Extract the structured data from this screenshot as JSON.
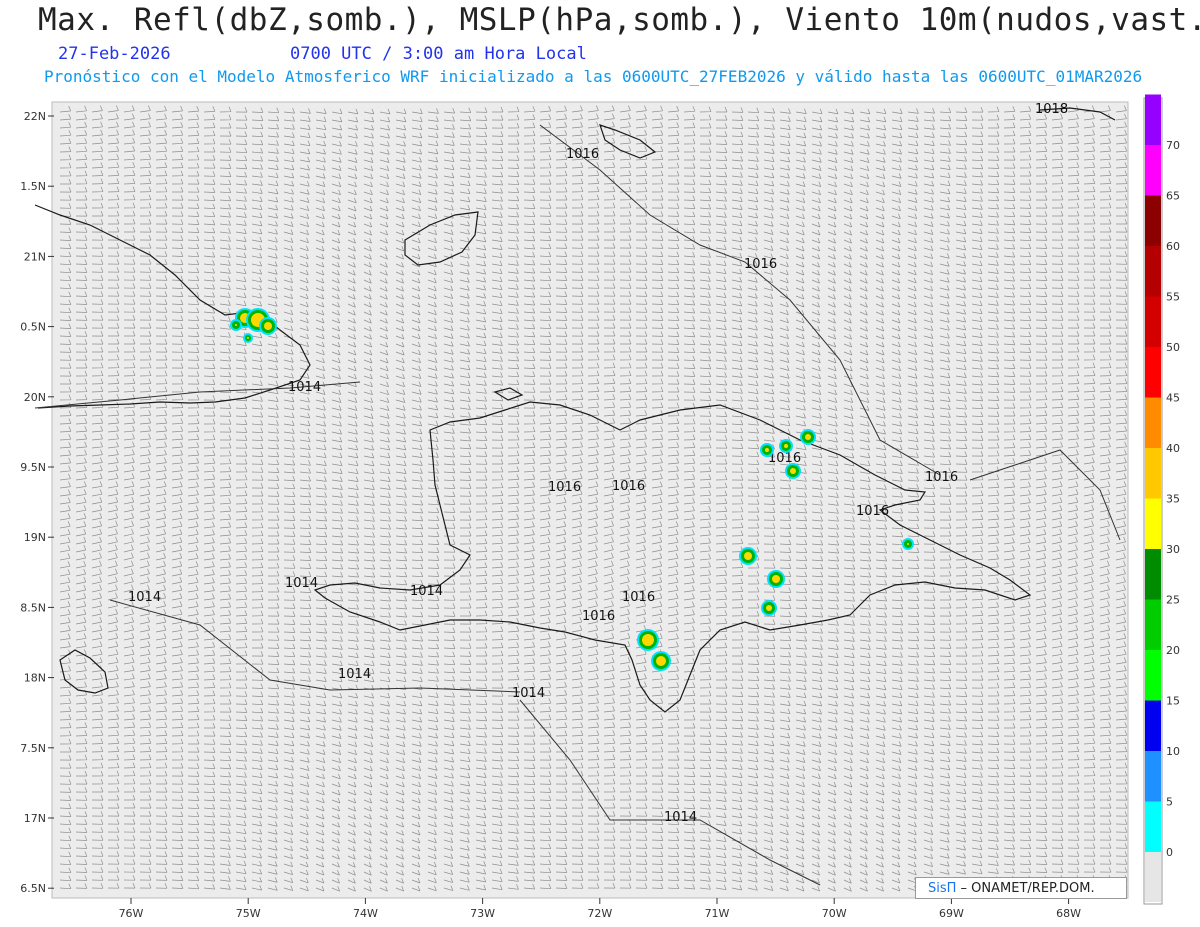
{
  "header": {
    "title": "Max. Refl(dbZ,somb.), MSLP(hPa,somb.), Viento 10m(nudos,vast.)",
    "date": "27-Feb-2026",
    "time": "0700 UTC / 3:00 am Hora Local",
    "description": "Pronóstico con el Modelo Atmosferico WRF inicializado a las 0600UTC_27FEB2026 y válido hasta las  0600UTC_01MAR2026"
  },
  "axes": {
    "lat_labels": [
      "22N",
      "1.5N",
      "21N",
      "0.5N",
      "20N",
      "9.5N",
      "19N",
      "8.5N",
      "18N",
      "7.5N",
      "17N",
      "6.5N"
    ],
    "lon_labels": [
      "76W",
      "75W",
      "74W",
      "73W",
      "72W",
      "71W",
      "70W",
      "69W",
      "68W"
    ]
  },
  "isobars": [
    "1018",
    "1016",
    "1016",
    "1014",
    "1016",
    "1016",
    "1016",
    "1016",
    "1016",
    "1016",
    "1014",
    "1014",
    "1014",
    "1016",
    "1014",
    "1014",
    "1014"
  ],
  "colorbar": {
    "levels": [
      "0",
      "5",
      "10",
      "15",
      "20",
      "25",
      "30",
      "35",
      "40",
      "45",
      "50",
      "55",
      "60",
      "65",
      "70"
    ],
    "colors": [
      "#00ffff",
      "#1e90ff",
      "#0000f0",
      "#00ff00",
      "#00cc00",
      "#008c00",
      "#ffff00",
      "#ffc800",
      "#ff8c00",
      "#ff0000",
      "#d40000",
      "#b40000",
      "#8c0000",
      "#ff00ff",
      "#9600ff"
    ]
  },
  "credit": {
    "brand": "SisΠ",
    "text": " – ONAMET/REP.DOM."
  }
}
